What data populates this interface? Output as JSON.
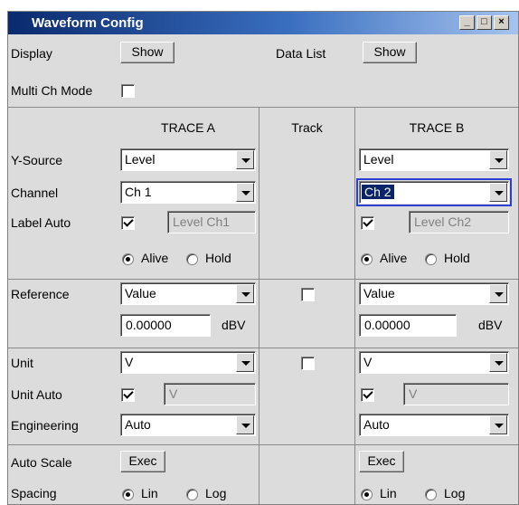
{
  "window": {
    "title": "Waveform Config",
    "buttons": [
      "_",
      "□",
      "×"
    ]
  },
  "top": {
    "display_label": "Display",
    "display_button": "Show",
    "datalist_label": "Data List",
    "datalist_button": "Show",
    "multich_label": "Multi Ch Mode",
    "multich_checked": false
  },
  "headers": {
    "trace_a": "TRACE A",
    "track": "Track",
    "trace_b": "TRACE B"
  },
  "rows": {
    "ysource": "Y-Source",
    "channel": "Channel",
    "label_auto": "Label Auto",
    "reference": "Reference",
    "unit": "Unit",
    "unit_auto": "Unit Auto",
    "engineering": "Engineering",
    "auto_scale": "Auto Scale",
    "spacing": "Spacing"
  },
  "trace_a": {
    "ysource": "Level",
    "channel": "Ch 1",
    "label_auto_checked": true,
    "label": "Level Ch1",
    "alive": "Alive",
    "hold": "Hold",
    "mode": "Alive",
    "reference": "Value",
    "ref_value": "0.00000",
    "ref_unit": "dBV",
    "unit": "V",
    "unit_auto_checked": true,
    "unit_auto_value": "V",
    "engineering": "Auto",
    "exec": "Exec",
    "lin": "Lin",
    "log": "Log",
    "spacing": "Lin"
  },
  "track": {
    "reference_checked": false,
    "unit_checked": false
  },
  "trace_b": {
    "ysource": "Level",
    "channel": "Ch 2",
    "label_auto_checked": true,
    "label": "Level Ch2",
    "alive": "Alive",
    "hold": "Hold",
    "mode": "Alive",
    "reference": "Value",
    "ref_value": "0.00000",
    "ref_unit": "dBV",
    "unit": "V",
    "unit_auto_checked": true,
    "unit_auto_value": "V",
    "engineering": "Auto",
    "exec": "Exec",
    "lin": "Lin",
    "log": "Log",
    "spacing": "Lin"
  },
  "colors": {
    "title_start": "#0a2a6e",
    "title_end": "#a6c4ee",
    "panel": "#dcdcdc",
    "focus": "#2d3fd0",
    "selection": "#0a246a"
  }
}
